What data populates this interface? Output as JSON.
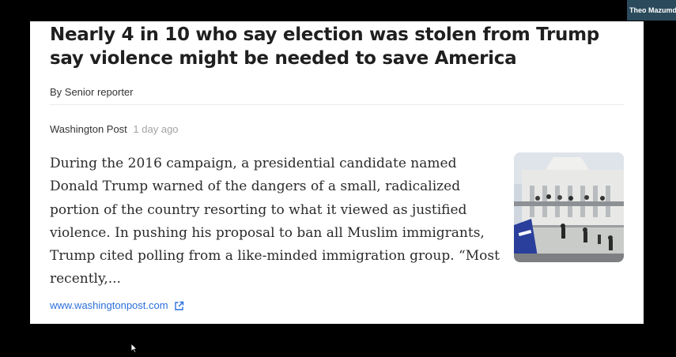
{
  "article": {
    "headline": "Nearly 4 in 10 who say election was stolen from Trump say violence might be needed to save America",
    "byline": "By Senior reporter",
    "source": "Washington Post",
    "time_ago": "1 day ago",
    "excerpt": "During the 2016 campaign, a presidential candidate named Donald Trump warned of the dangers of a small, radicalized portion of the country resorting to what it viewed as justified violence. In pushing his proposal to ban all Muslim immigrants, Trump cited polling from a like-minded immigration group. “Most recently,...",
    "link_url": "www.washingtonpost.com",
    "link_icon": "external-link-icon",
    "link_color": "#2a6fdb"
  },
  "participant": {
    "name": "Theo Mazumdar"
  },
  "colors": {
    "background": "#000000",
    "card": "#ffffff",
    "headline": "#1f1f1f",
    "meta_muted": "#a3a3a3"
  }
}
